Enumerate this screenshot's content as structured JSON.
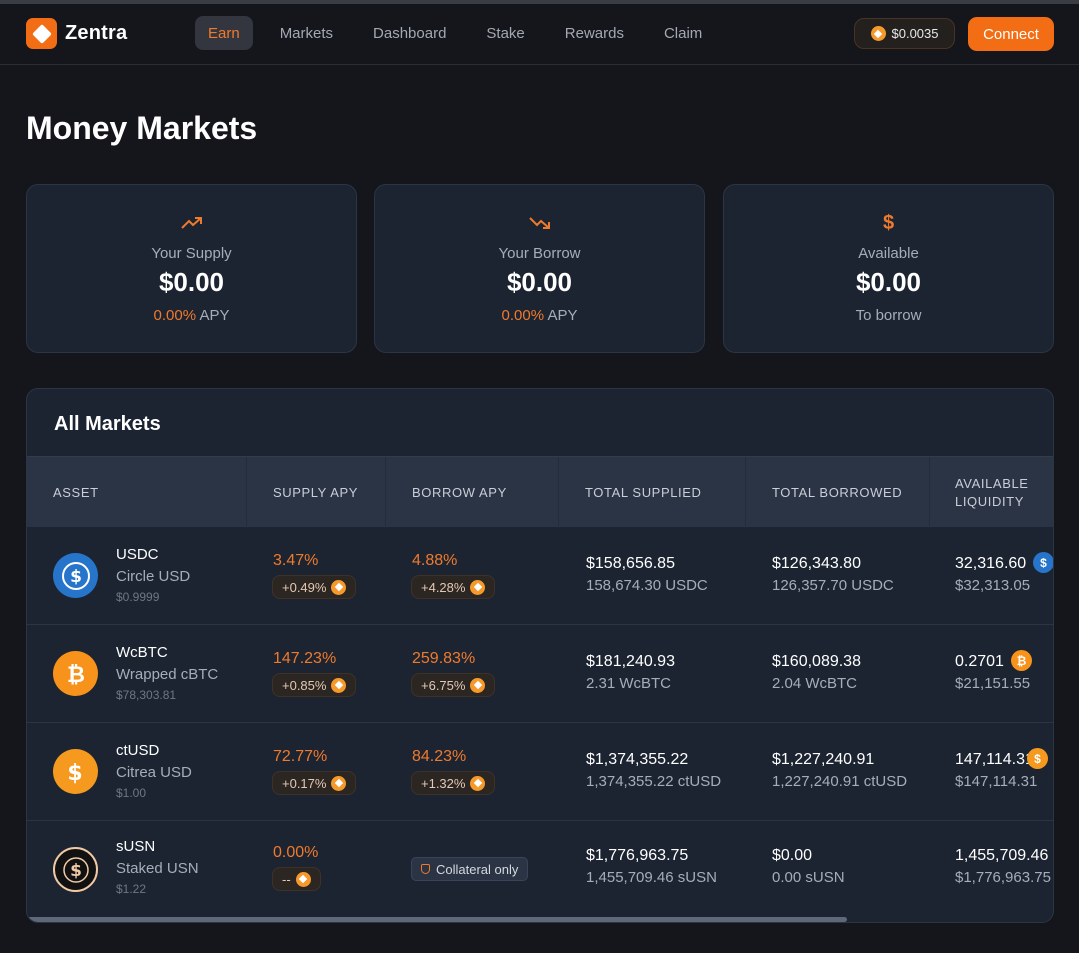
{
  "app": {
    "name": "Zentra"
  },
  "nav": [
    "Earn",
    "Markets",
    "Dashboard",
    "Stake",
    "Rewards",
    "Claim"
  ],
  "header": {
    "token_price": "$0.0035",
    "connect_label": "Connect"
  },
  "page": {
    "title": "Money Markets"
  },
  "stats": [
    {
      "label": "Your Supply",
      "value": "$0.00",
      "pct": "0.00%",
      "suffix": "APY",
      "icon": "trending-up-icon"
    },
    {
      "label": "Your Borrow",
      "value": "$0.00",
      "pct": "0.00%",
      "suffix": "APY",
      "icon": "trending-down-icon"
    },
    {
      "label": "Available",
      "value": "$0.00",
      "pct": "",
      "suffix": "To borrow",
      "icon": "dollar-icon"
    }
  ],
  "markets": {
    "title": "All Markets",
    "columns": [
      "ASSET",
      "SUPPLY APY",
      "BORROW APY",
      "TOTAL SUPPLIED",
      "TOTAL BORROWED",
      "AVAILABLE LIQUIDITY"
    ],
    "rows": [
      {
        "symbol": "USDC",
        "name": "Circle USD",
        "price": "$0.9999",
        "supply_apy": "3.47%",
        "supply_bonus": "+0.49%",
        "borrow_apy": "4.88%",
        "borrow_bonus": "+4.28%",
        "supplied": "$158,656.85",
        "supplied_amt": "158,674.30 USDC",
        "borrowed": "$126,343.80",
        "borrowed_amt": "126,357.70 USDC",
        "liquidity": "32,316.60",
        "liquidity_usd": "$32,313.05",
        "icon_color": "#2775ca"
      },
      {
        "symbol": "WcBTC",
        "name": "Wrapped cBTC",
        "price": "$78,303.81",
        "supply_apy": "147.23%",
        "supply_bonus": "+0.85%",
        "borrow_apy": "259.83%",
        "borrow_bonus": "+6.75%",
        "supplied": "$181,240.93",
        "supplied_amt": "2.31 WcBTC",
        "borrowed": "$160,089.38",
        "borrowed_amt": "2.04 WcBTC",
        "liquidity": "0.2701",
        "liquidity_usd": "$21,151.55",
        "icon_color": "#f7931a"
      },
      {
        "symbol": "ctUSD",
        "name": "Citrea USD",
        "price": "$1.00",
        "supply_apy": "72.77%",
        "supply_bonus": "+0.17%",
        "borrow_apy": "84.23%",
        "borrow_bonus": "+1.32%",
        "supplied": "$1,374,355.22",
        "supplied_amt": "1,374,355.22 ctUSD",
        "borrowed": "$1,227,240.91",
        "borrowed_amt": "1,227,240.91 ctUSD",
        "liquidity": "147,114.31",
        "liquidity_usd": "$147,114.31",
        "icon_color": "#f59a1f"
      },
      {
        "symbol": "sUSN",
        "name": "Staked USN",
        "price": "$1.22",
        "supply_apy": "0.00%",
        "supply_bonus": "--",
        "borrow_apy": "",
        "borrow_bonus": "",
        "borrow_note": "Collateral only",
        "supplied": "$1,776,963.75",
        "supplied_amt": "1,455,709.46 sUSN",
        "borrowed": "$0.00",
        "borrowed_amt": "0.00 sUSN",
        "liquidity": "1,455,709.46",
        "liquidity_usd": "$1,776,963.75",
        "icon_color": "#111111"
      }
    ]
  }
}
